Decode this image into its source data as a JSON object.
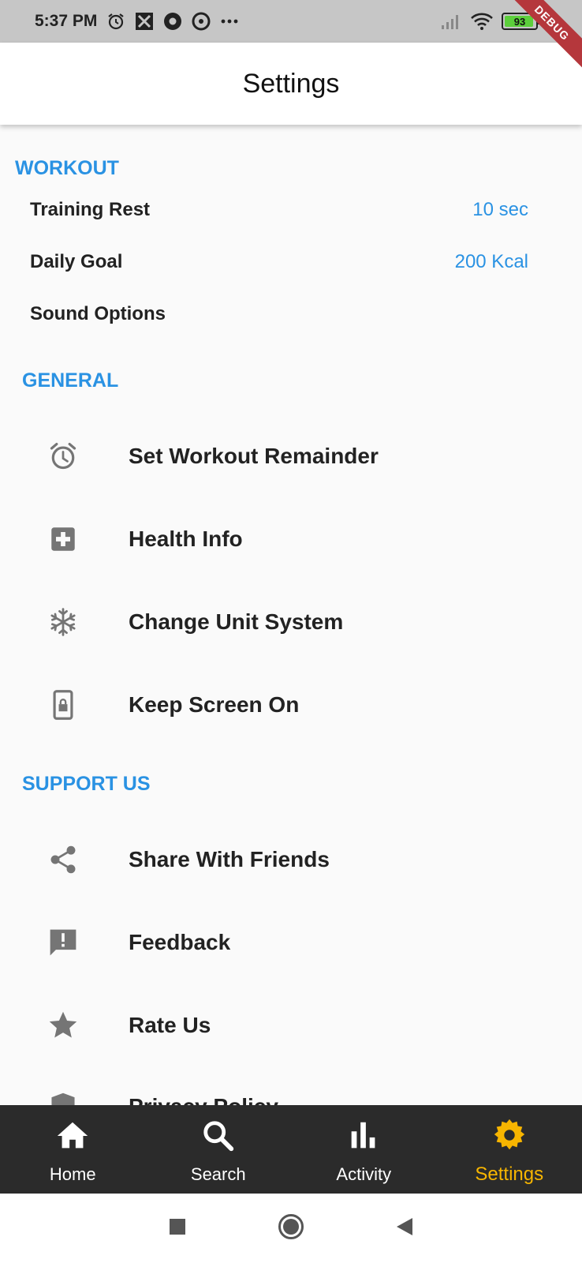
{
  "status_bar": {
    "time": "5:37 PM",
    "battery_level": "93",
    "debug_label": "DEBUG"
  },
  "appbar": {
    "title": "Settings"
  },
  "workout": {
    "header": "WORKOUT",
    "items": [
      {
        "label": "Training Rest",
        "value": "10 sec"
      },
      {
        "label": "Daily Goal",
        "value": "200 Kcal"
      },
      {
        "label": "Sound Options",
        "value": ""
      }
    ]
  },
  "general": {
    "header": "GENERAL",
    "items": [
      {
        "label": "Set Workout Remainder",
        "icon": "alarm-icon"
      },
      {
        "label": "Health Info",
        "icon": "medical-cross-icon"
      },
      {
        "label": "Change Unit System",
        "icon": "snowflake-icon"
      },
      {
        "label": "Keep Screen On",
        "icon": "screen-lock-icon"
      }
    ]
  },
  "support": {
    "header": "SUPPORT US",
    "items": [
      {
        "label": "Share With Friends",
        "icon": "share-icon"
      },
      {
        "label": "Feedback",
        "icon": "feedback-icon"
      },
      {
        "label": "Rate Us",
        "icon": "star-icon"
      },
      {
        "label": "Privacy Policy",
        "icon": "shield-icon"
      }
    ]
  },
  "bottom_nav": {
    "items": [
      {
        "label": "Home",
        "icon": "home-icon"
      },
      {
        "label": "Search",
        "icon": "search-icon"
      },
      {
        "label": "Activity",
        "icon": "bar-chart-icon"
      },
      {
        "label": "Settings",
        "icon": "gear-icon",
        "active": true
      }
    ]
  },
  "colors": {
    "accent": "#2a92e3",
    "active_nav": "#f7b500",
    "icon_gray": "#757575",
    "nav_bg": "#2b2b2b"
  }
}
